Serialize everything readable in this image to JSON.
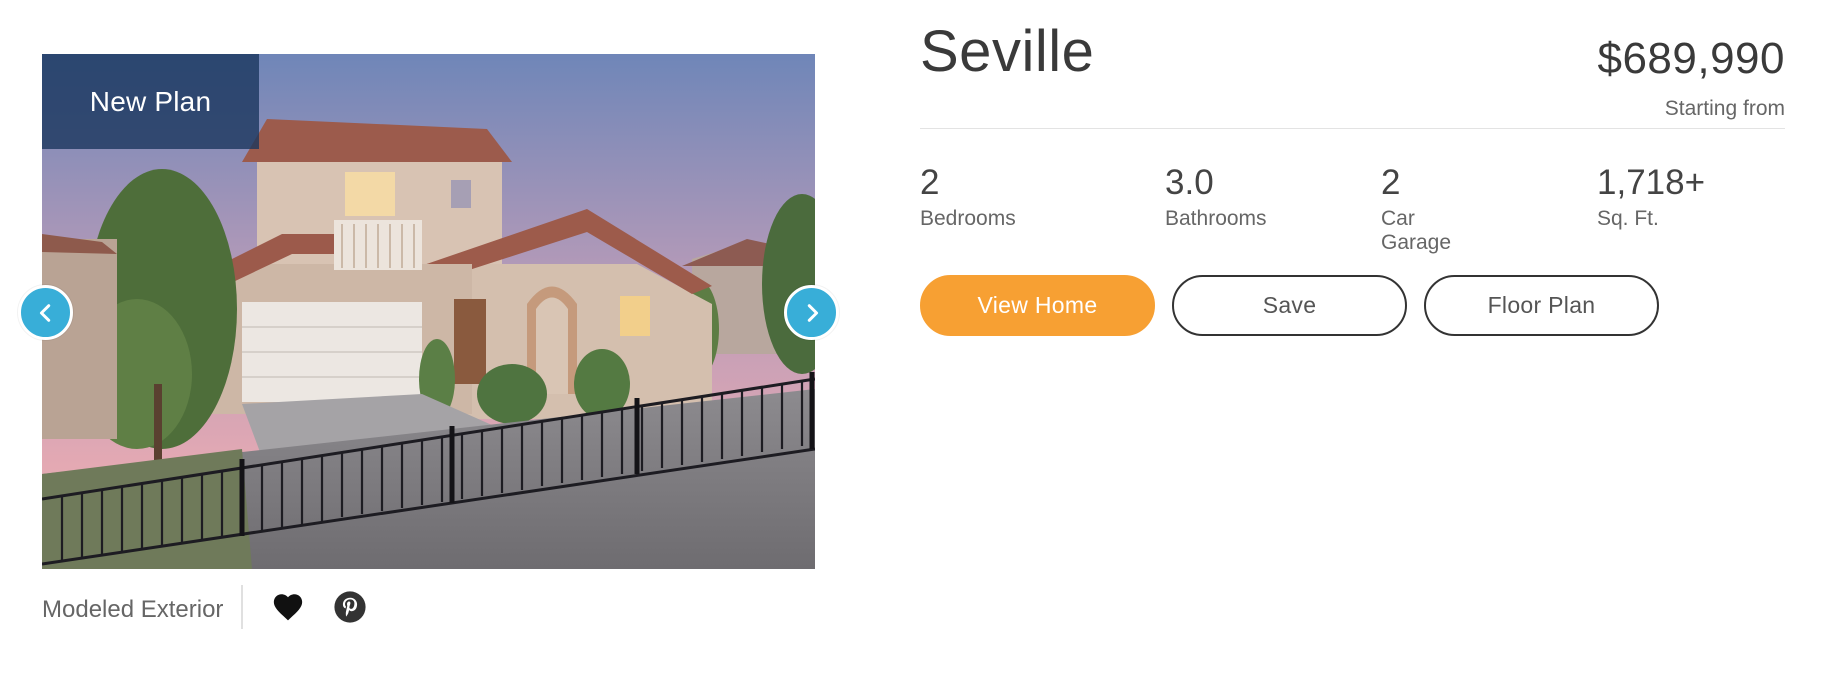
{
  "gallery": {
    "badge": "New Plan",
    "prev_icon": "chevron-left-icon",
    "next_icon": "chevron-right-icon",
    "caption": "Modeled Exterior",
    "favorite_icon": "heart-icon",
    "pin_icon": "pinterest-icon",
    "accent_color": "#38aed8"
  },
  "plan": {
    "name": "Seville",
    "price": "$689,990",
    "price_note": "Starting from"
  },
  "stats": [
    {
      "value": "2",
      "label": "Bedrooms"
    },
    {
      "value": "3.0",
      "label": "Bathrooms"
    },
    {
      "value": "2",
      "label": "Car Garage"
    },
    {
      "value": "1,718+",
      "label": "Sq. Ft."
    }
  ],
  "actions": {
    "view_home": "View Home",
    "save": "Save",
    "floor_plan": "Floor Plan",
    "primary_color": "#f7a033"
  }
}
